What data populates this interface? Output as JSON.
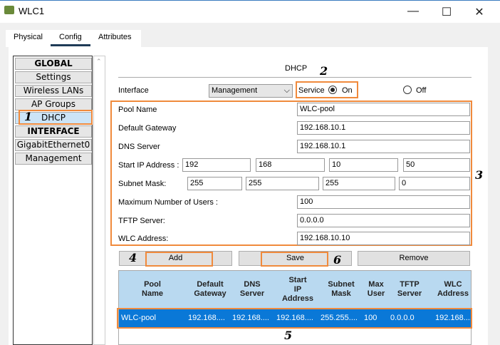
{
  "window": {
    "title": "WLC1",
    "min": "—",
    "max": "☐",
    "close": "✕"
  },
  "tabs": [
    "Physical",
    "Config",
    "Attributes"
  ],
  "sidebar": {
    "items": [
      {
        "label": "GLOBAL",
        "header": true
      },
      {
        "label": "Settings"
      },
      {
        "label": "Wireless LANs"
      },
      {
        "label": "AP Groups"
      },
      {
        "label": "DHCP",
        "selected": true
      },
      {
        "label": "INTERFACE",
        "header": true
      },
      {
        "label": "GigabitEthernet0"
      },
      {
        "label": "Management"
      }
    ]
  },
  "dhcp": {
    "title": "DHCP",
    "interface_label": "Interface",
    "interface_value": "Management",
    "service_label": "Service",
    "on_label": "On",
    "off_label": "Off",
    "service_on": true,
    "pool_name_label": "Pool Name",
    "pool_name": "WLC-pool",
    "gateway_label": "Default Gateway",
    "gateway": "192.168.10.1",
    "dns_label": "DNS Server",
    "dns": "192.168.10.1",
    "start_ip_label": "Start IP Address :",
    "start_ip": [
      "192",
      "168",
      "10",
      "50"
    ],
    "mask_label": "Subnet Mask:",
    "mask": [
      "255",
      "255",
      "255",
      "0"
    ],
    "max_users_label": "Maximum Number of Users :",
    "max_users": "100",
    "tftp_label": "TFTP Server:",
    "tftp": "0.0.0.0",
    "wlc_label": "WLC Address:",
    "wlc": "192.168.10.10",
    "add": "Add",
    "save": "Save",
    "remove": "Remove"
  },
  "table": {
    "headers": [
      "Pool\nName",
      "Default\nGateway",
      "DNS\nServer",
      "Start\nIP\nAddress",
      "Subnet\nMask",
      "Max\nUser",
      "TFTP\nServer",
      "WLC\nAddress"
    ],
    "rows": [
      [
        "WLC-pool",
        "192.168....",
        "192.168....",
        "192.168....",
        "255.255....",
        "100",
        "0.0.0.0",
        "192.168...."
      ]
    ]
  },
  "annotations": [
    "1",
    "2",
    "3",
    "4",
    "5",
    "6"
  ],
  "colors": {
    "accent": "#f08a3c",
    "selected_row": "#0a78d7",
    "header": "#b9d9f0"
  }
}
